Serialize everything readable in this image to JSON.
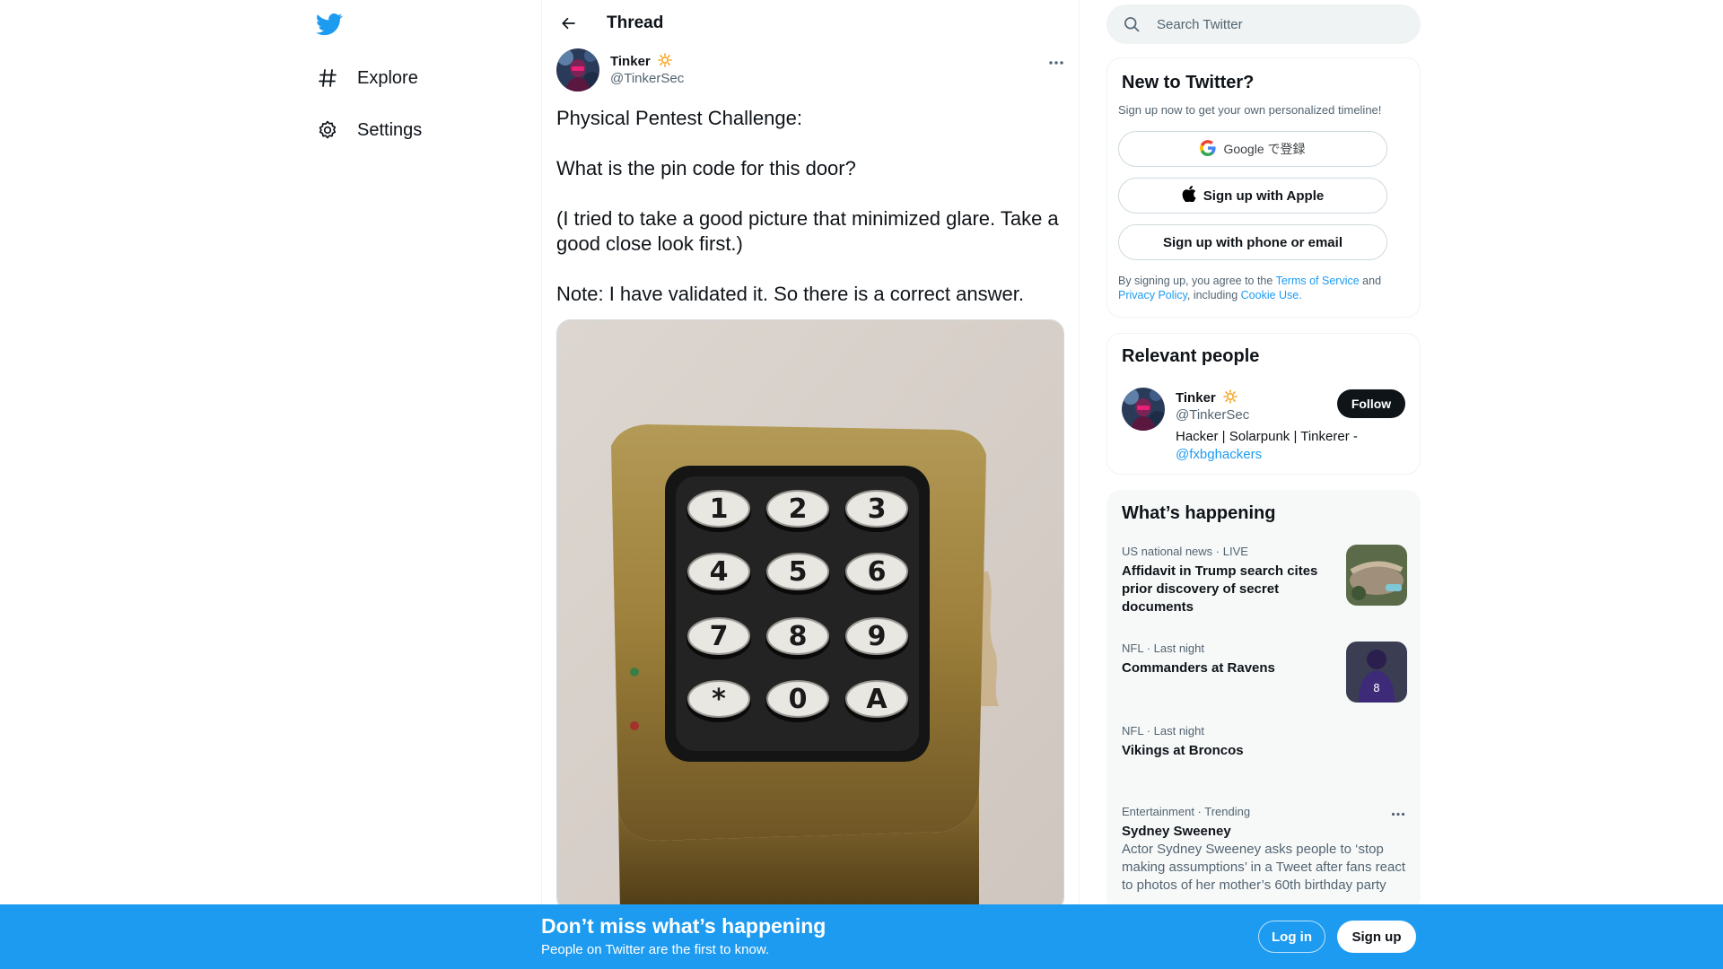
{
  "nav": {
    "logo": "twitter-bird-icon",
    "items": [
      {
        "label": "Explore",
        "icon": "hashtag-icon"
      },
      {
        "label": "Settings",
        "icon": "gear-icon"
      }
    ]
  },
  "thread": {
    "title": "Thread",
    "author": {
      "name": "Tinker",
      "emoji": "🔆",
      "handle": "@TinkerSec"
    },
    "paragraphs": [
      "Physical Pentest Challenge:",
      "What is the pin code for this door?",
      "(I tried to take a good picture that minimized glare. Take a good close look first.)",
      "Note: I have validated it. So there is a correct answer."
    ],
    "keypad_keys": [
      "1",
      "2",
      "3",
      "4",
      "5",
      "6",
      "7",
      "8",
      "9",
      "*",
      "0",
      "A"
    ]
  },
  "search": {
    "placeholder": "Search Twitter"
  },
  "new_to_twitter": {
    "title": "New to Twitter?",
    "subtitle": "Sign up now to get your own personalized timeline!",
    "google_label": "Google で登録",
    "apple_label": "Sign up with Apple",
    "phone_label": "Sign up with phone or email",
    "terms_prefix": "By signing up, you agree to the ",
    "terms_link": "Terms of Service",
    "terms_and": " and ",
    "privacy_link": "Privacy Policy",
    "terms_including": ", including ",
    "cookie_link": "Cookie Use."
  },
  "relevant_people": {
    "title": "Relevant people",
    "person": {
      "name": "Tinker",
      "emoji": "🔆",
      "handle": "@TinkerSec",
      "bio": "Hacker | Solarpunk | Tinkerer - ",
      "bio_link": "@fxbghackers",
      "follow_label": "Follow"
    }
  },
  "whats_happening": {
    "title": "What’s happening",
    "trends": [
      {
        "meta": "US national news · LIVE",
        "headline": "Affidavit in Trump search cites prior discovery of secret documents"
      },
      {
        "meta": "NFL · Last night",
        "headline": "Commanders at Ravens"
      },
      {
        "meta": "NFL · Last night",
        "headline": "Vikings at Broncos"
      },
      {
        "meta": "Entertainment · Trending",
        "headline": "Sydney Sweeney",
        "desc": "Actor Sydney Sweeney asks people to ‘stop making assumptions’ in a Tweet after fans react to photos of her mother’s 60th birthday party"
      }
    ]
  },
  "bottom_bar": {
    "title": "Don’t miss what’s happening",
    "subtitle": "People on Twitter are the first to know.",
    "login_label": "Log in",
    "signup_label": "Sign up"
  },
  "colors": {
    "accent": "#1d9bf0",
    "text": "#0f1419",
    "muted": "#536471"
  }
}
